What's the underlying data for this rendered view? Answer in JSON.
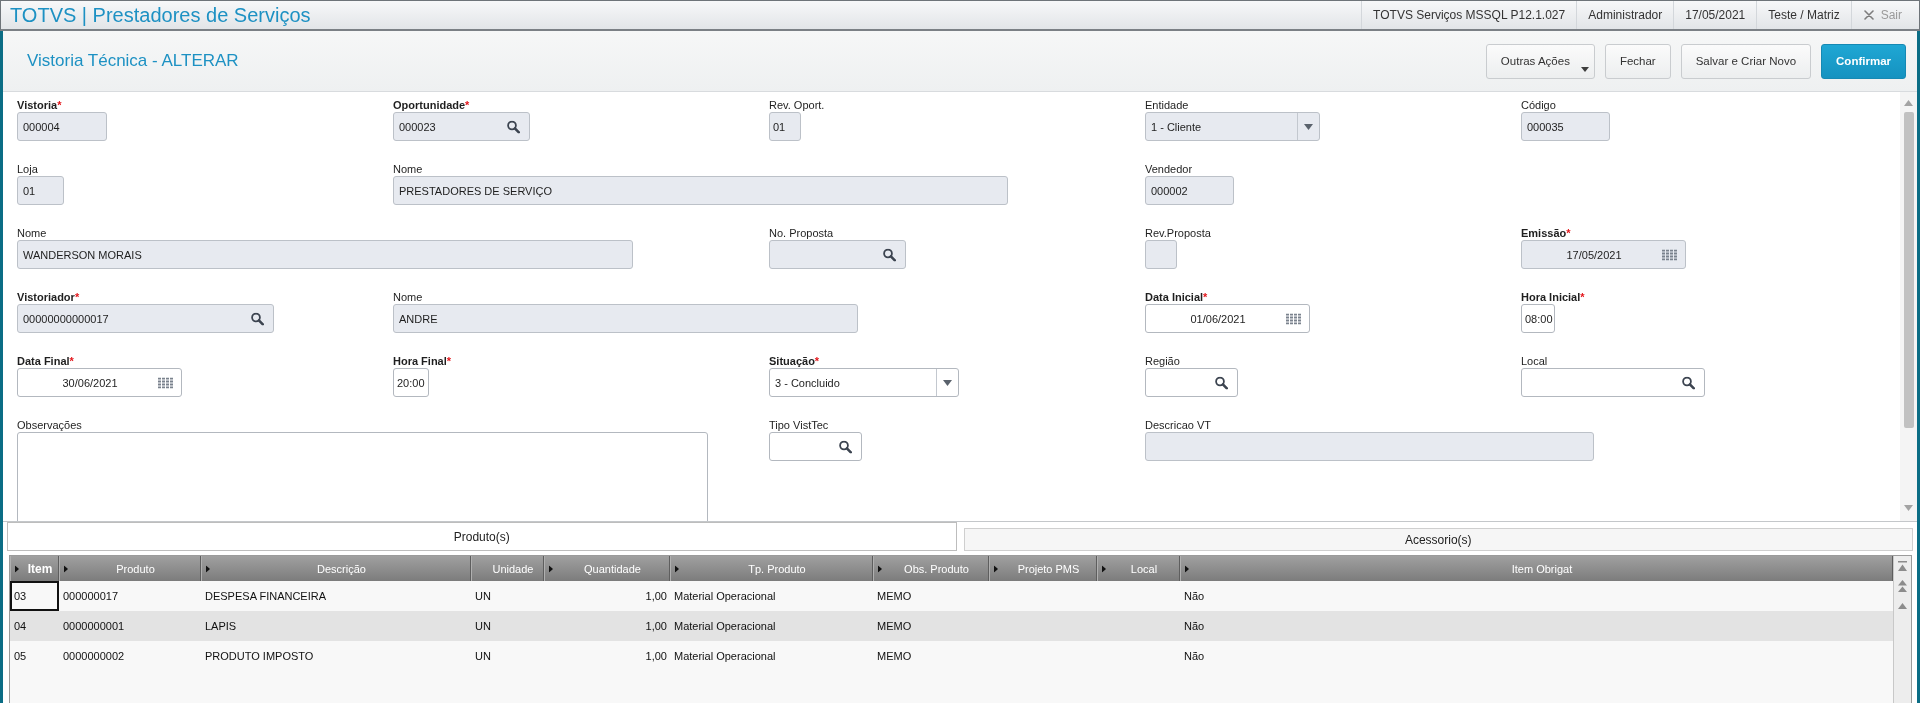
{
  "app_bar": {
    "title": "TOTVS | Prestadores de Serviços",
    "info": [
      "TOTVS Serviços MSSQL P12.1.027",
      "Administrador",
      "17/05/2021",
      "Teste / Matriz"
    ],
    "logout": "Sair"
  },
  "page_header": {
    "title": "Vistoria Técnica - ALTERAR",
    "actions": [
      {
        "label": "Outras Ações",
        "kind": "menu"
      },
      {
        "label": "Fechar",
        "kind": "default"
      },
      {
        "label": "Salvar e Criar Novo",
        "kind": "default"
      },
      {
        "label": "Confirmar",
        "kind": "primary"
      }
    ]
  },
  "form": {
    "rows": [
      [
        {
          "label": "Vistoria",
          "required": true,
          "mark": "*",
          "kind": "text",
          "readonly": true,
          "value": "000004"
        },
        {
          "label": "Oportunidade",
          "required": true,
          "mark": "*",
          "kind": "lookup",
          "readonly": true,
          "value": "000023"
        },
        {
          "label": "Rev. Oport.",
          "required": false,
          "kind": "text",
          "readonly": true,
          "value": "01"
        },
        {
          "label": "Entidade",
          "required": false,
          "kind": "select",
          "readonly": true,
          "value": "1 - Cliente"
        },
        {
          "label": "Código",
          "required": false,
          "kind": "text",
          "readonly": true,
          "value": "000035"
        }
      ],
      [
        {
          "label": "Loja",
          "required": false,
          "kind": "text",
          "readonly": true,
          "value": "01"
        },
        {
          "label": "Nome",
          "required": false,
          "kind": "text",
          "readonly": true,
          "value": "PRESTADORES DE SERVIÇO"
        },
        {
          "label": "Vendedor",
          "required": false,
          "kind": "text",
          "readonly": true,
          "value": "000002"
        }
      ],
      [
        {
          "label": "Nome",
          "required": false,
          "kind": "text",
          "readonly": true,
          "value": "WANDERSON MORAIS"
        },
        {
          "label": "No. Proposta",
          "required": false,
          "kind": "lookup",
          "readonly": true
        },
        {
          "label": "Rev.Proposta",
          "required": false,
          "kind": "text",
          "readonly": true
        },
        {
          "label": "Emissão",
          "required": true,
          "mark": "*",
          "kind": "date",
          "readonly": true,
          "value": "17/05/2021"
        }
      ],
      [
        {
          "label": "Vistoriador",
          "required": true,
          "mark": "*",
          "kind": "lookup",
          "readonly": true,
          "value": "00000000000017"
        },
        {
          "label": "Nome",
          "required": false,
          "kind": "text",
          "readonly": true,
          "value": "ANDRE"
        },
        {
          "label": "Data Inicial",
          "required": true,
          "mark": "*",
          "kind": "date",
          "readonly": false,
          "value": "01/06/2021"
        },
        {
          "label": "Hora Inicial",
          "required": true,
          "mark": "*",
          "kind": "text",
          "readonly": false,
          "value": "08:00"
        }
      ],
      [
        {
          "label": "Data Final",
          "required": true,
          "mark": "*",
          "kind": "date",
          "readonly": false,
          "value": "30/06/2021"
        },
        {
          "label": "Hora Final",
          "required": true,
          "mark": "*",
          "kind": "text",
          "readonly": false,
          "value": "20:00"
        },
        {
          "label": "Situação",
          "required": true,
          "mark": "*",
          "kind": "select",
          "readonly": false,
          "value": "3 - Concluido"
        },
        {
          "label": "Região",
          "required": false,
          "kind": "lookup",
          "readonly": false
        },
        {
          "label": "Local",
          "required": false,
          "kind": "lookup",
          "readonly": false
        }
      ],
      [
        {
          "label": "Observações",
          "required": false,
          "kind": "memo",
          "readonly": false
        },
        {
          "label": "Tipo VistTec",
          "required": false,
          "kind": "lookup",
          "readonly": false
        },
        {
          "label": "Descricao VT",
          "required": false,
          "kind": "text",
          "readonly": true
        }
      ]
    ]
  },
  "tabs": [
    {
      "label": "Produto(s)",
      "selected": true
    },
    {
      "label": "Acessorio(s)",
      "selected": false
    }
  ],
  "grid": {
    "columns": [
      {
        "label": "Item",
        "sorted": true,
        "marker": true,
        "kind": "text"
      },
      {
        "label": "Produto",
        "sorted": false,
        "marker": true,
        "kind": "text"
      },
      {
        "label": "Descrição",
        "sorted": false,
        "marker": true,
        "kind": "text"
      },
      {
        "label": "Unidade",
        "sorted": false,
        "marker": false,
        "kind": "text"
      },
      {
        "label": "Quantidade",
        "sorted": false,
        "marker": true,
        "kind": "number"
      },
      {
        "label": "Tp. Produto",
        "sorted": false,
        "marker": true,
        "kind": "text"
      },
      {
        "label": "Obs. Produto",
        "sorted": false,
        "marker": true,
        "kind": "text"
      },
      {
        "label": "Projeto PMS",
        "sorted": false,
        "marker": true,
        "kind": "text"
      },
      {
        "label": "Local",
        "sorted": false,
        "marker": true,
        "kind": "text"
      },
      {
        "label": "Item Obrigat",
        "sorted": false,
        "marker": true,
        "kind": "text"
      }
    ],
    "rows": [
      {
        "selected": true,
        "item": "03",
        "produto": "000000017",
        "descricao": "DESPESA FINANCEIRA",
        "unidade": "UN",
        "quantidade": "1,00",
        "tp_produto": "Material Operacional",
        "obs_produto": "MEMO",
        "item_obrigat": "Não"
      },
      {
        "selected": false,
        "item": "04",
        "produto": "0000000001",
        "descricao": "LAPIS",
        "unidade": "UN",
        "quantidade": "1,00",
        "tp_produto": "Material Operacional",
        "obs_produto": "MEMO",
        "item_obrigat": "Não"
      },
      {
        "selected": false,
        "item": "05",
        "produto": "0000000002",
        "descricao": "PRODUTO IMPOSTO",
        "unidade": "UN",
        "quantidade": "1,00",
        "tp_produto": "Material Operacional",
        "obs_produto": "MEMO",
        "item_obrigat": "Não"
      }
    ]
  }
}
